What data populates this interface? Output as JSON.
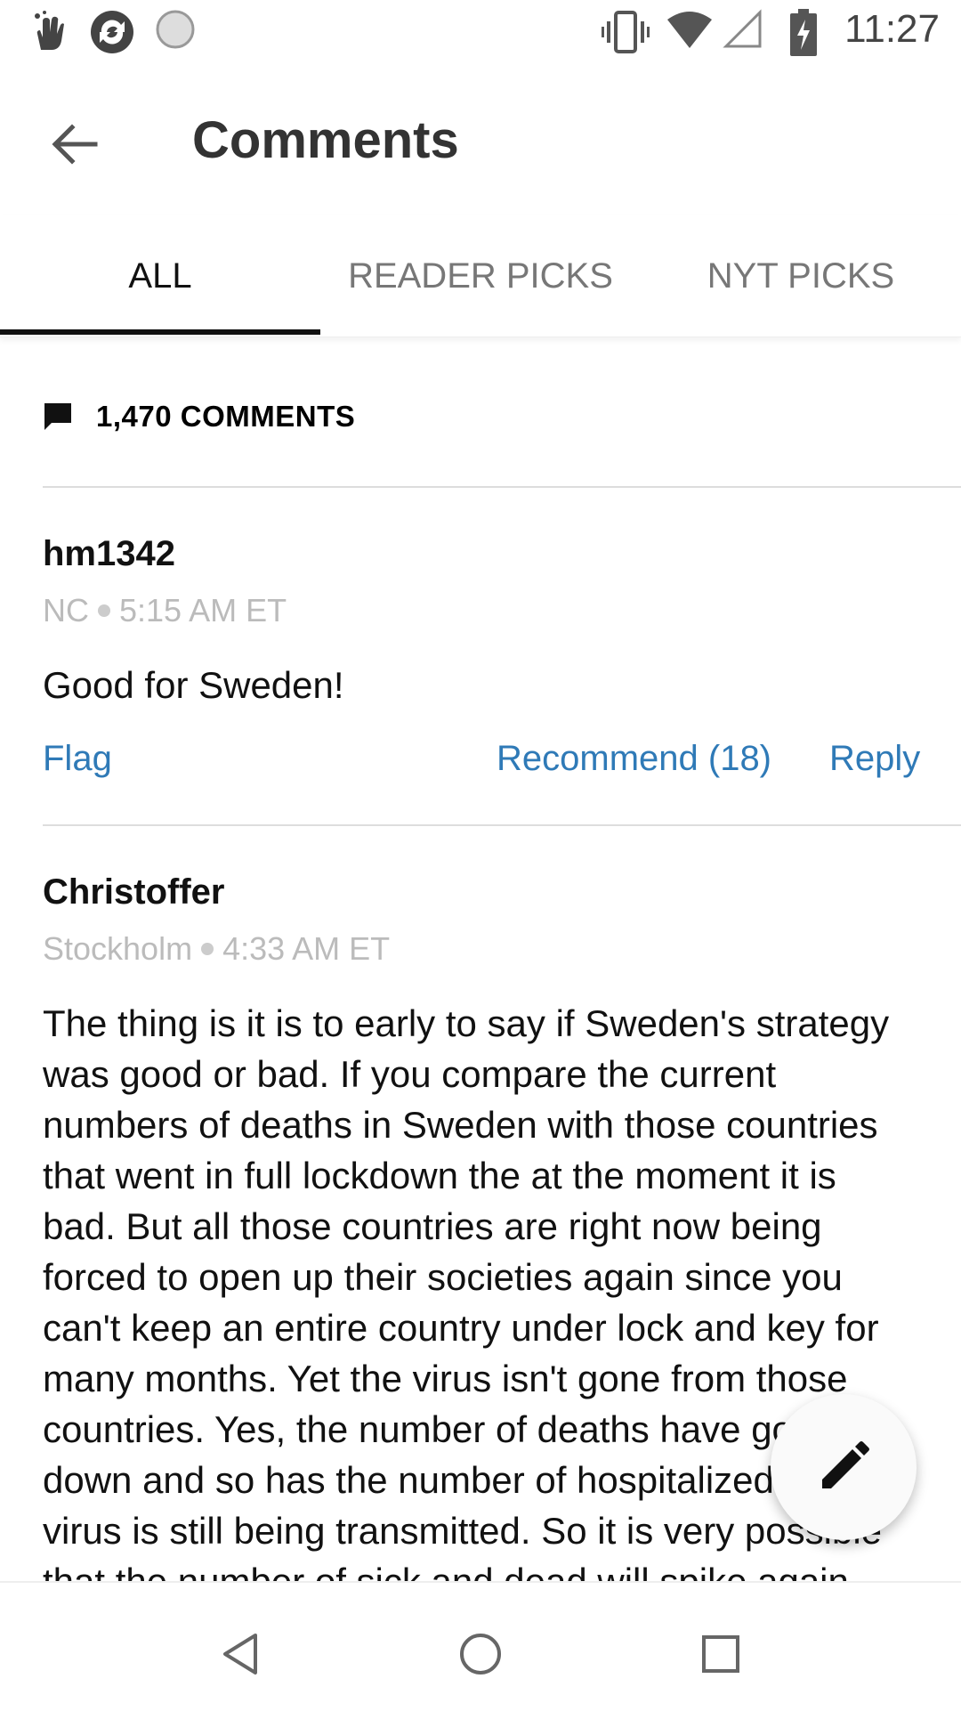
{
  "status_bar": {
    "time": "11:27",
    "icons": [
      "gesture-icon",
      "sync-icon",
      "loading-icon",
      "vibrate-icon",
      "wifi-icon",
      "signal-icon",
      "battery-charging-icon"
    ]
  },
  "header": {
    "title": "Comments"
  },
  "tabs": [
    {
      "label": "ALL",
      "active": true
    },
    {
      "label": "READER PICKS",
      "active": false
    },
    {
      "label": "NYT PICKS",
      "active": false
    }
  ],
  "comment_count": "1,470 COMMENTS",
  "comments": [
    {
      "author": "hm1342",
      "location": "NC",
      "time": "5:15 AM ET",
      "body": "Good for Sweden!",
      "actions": {
        "flag": "Flag",
        "recommend": "Recommend (18)",
        "reply": "Reply"
      }
    },
    {
      "author": "Christoffer",
      "location": "Stockholm",
      "time": "4:33 AM ET",
      "body": "The thing is it is to early to say if Sweden's strategy was good or bad. If you compare the current numbers of deaths in Sweden with those countries that went in full lockdown the at the moment it is bad. But all those countries are right now being forced to open up their societies again since you can't keep an entire country under lock and key for many months. Yet the virus isn't gone from those countries. Yes, the number of deaths have gone down and so has the number of hospitalized but the virus is still being transmitted. So it is very possible that the number of sick and dead will spike again"
    }
  ],
  "fab": {
    "icon": "pencil-icon"
  },
  "nav_bar": {
    "icons": [
      "back-triangle-icon",
      "home-circle-icon",
      "recents-square-icon"
    ]
  },
  "colors": {
    "link": "#2f7ab7",
    "meta": "#bbbbbb",
    "divider": "#dddddd"
  }
}
